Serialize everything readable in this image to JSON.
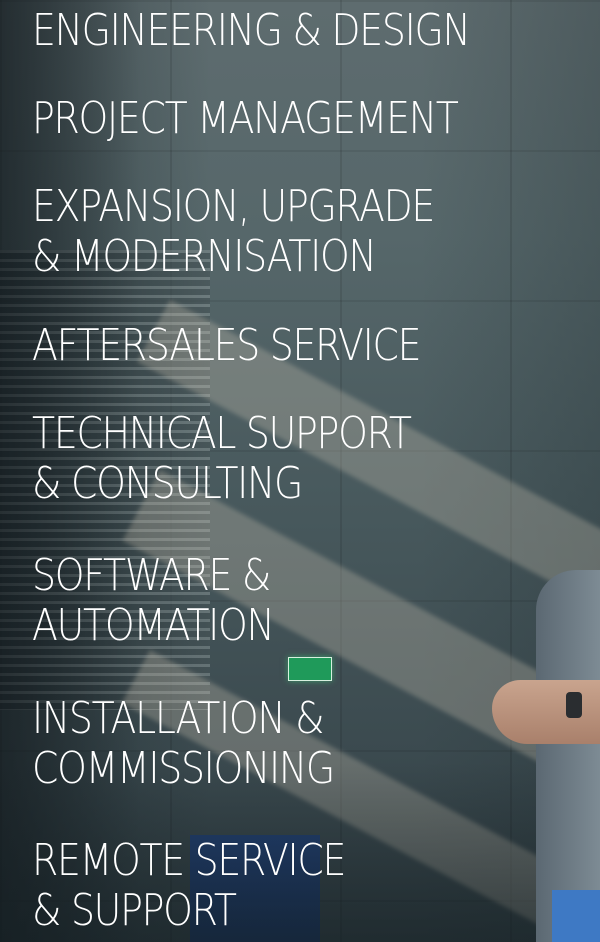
{
  "colors": {
    "text": "#ffffff",
    "background_tint": "#3a4a4e",
    "exit_sign": "#1f9a5a"
  },
  "background": {
    "icon": "warehouse-photo-icon"
  },
  "services": [
    {
      "label": "ENGINEERING & DESIGN"
    },
    {
      "label": "PROJECT MANAGEMENT"
    },
    {
      "label": "EXPANSION, UPGRADE\n& MODERNISATION"
    },
    {
      "label": "AFTERSALES SERVICE"
    },
    {
      "label": "TECHNICAL SUPPORT\n& CONSULTING"
    },
    {
      "label": "SOFTWARE &\nAUTOMATION"
    },
    {
      "label": "INSTALLATION &\nCOMMISSIONING"
    },
    {
      "label": "REMOTE SERVICE\n& SUPPORT"
    }
  ]
}
